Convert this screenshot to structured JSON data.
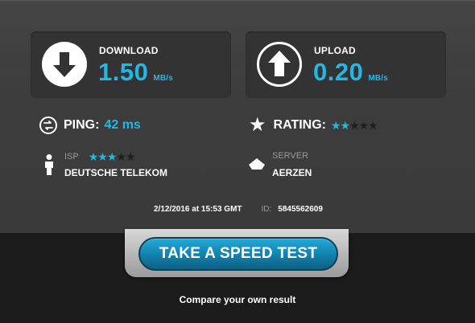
{
  "download": {
    "label": "DOWNLOAD",
    "value": "1.50",
    "unit": "MB/s"
  },
  "upload": {
    "label": "UPLOAD",
    "value": "0.20",
    "unit": "MB/s"
  },
  "ping": {
    "label": "PING:",
    "value": "42 ms"
  },
  "rating": {
    "label": "RATING:",
    "stars_filled": 2,
    "stars_total": 5
  },
  "isp": {
    "label": "ISP",
    "name": "DEUTSCHE TELEKOM",
    "stars_filled": 3,
    "stars_total": 5
  },
  "server": {
    "label": "SERVER",
    "name": "AERZEN"
  },
  "meta": {
    "date": "2/12/2016 at 15:53 GMT",
    "id_label": "ID:",
    "id_value": "5845562609"
  },
  "cta": {
    "button_label": "TAKE A SPEED TEST",
    "compare_text": "Compare your own result"
  },
  "colors": {
    "accent": "#22b8e6",
    "panel": "#333333",
    "background": "#3d3d3d"
  },
  "icons": {
    "download": "download-arrow-icon",
    "upload": "upload-arrow-icon",
    "ping": "ping-icon",
    "rating": "star-icon",
    "isp": "person-icon",
    "server": "server-icon"
  }
}
